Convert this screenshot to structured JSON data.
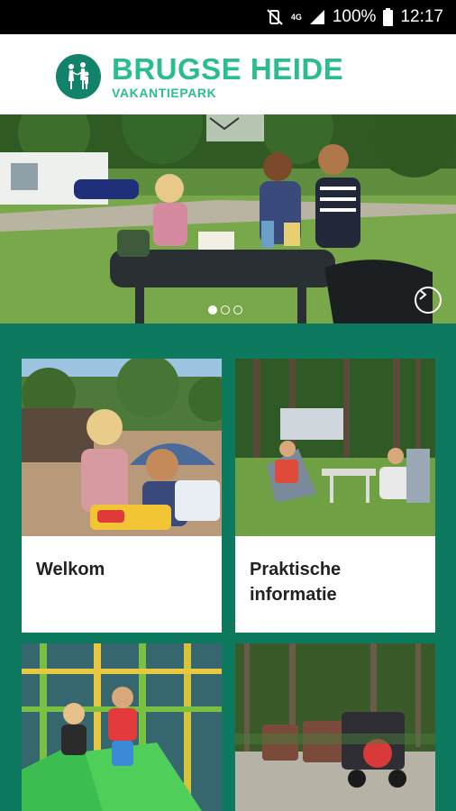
{
  "status_bar": {
    "network": "4G",
    "battery": "100%",
    "time": "12:17"
  },
  "header": {
    "brand_title": "BRUGSE HEIDE",
    "brand_subtitle": "VAKANTIEPARK"
  },
  "hero": {
    "slide_count": 3,
    "active_slide": 1
  },
  "tiles": [
    {
      "label": "Welkom"
    },
    {
      "label": "Praktische informatie"
    },
    {
      "label": ""
    },
    {
      "label": ""
    }
  ],
  "colors": {
    "brand_green": "#2bbd8f",
    "background_green": "#0d7a5f"
  }
}
